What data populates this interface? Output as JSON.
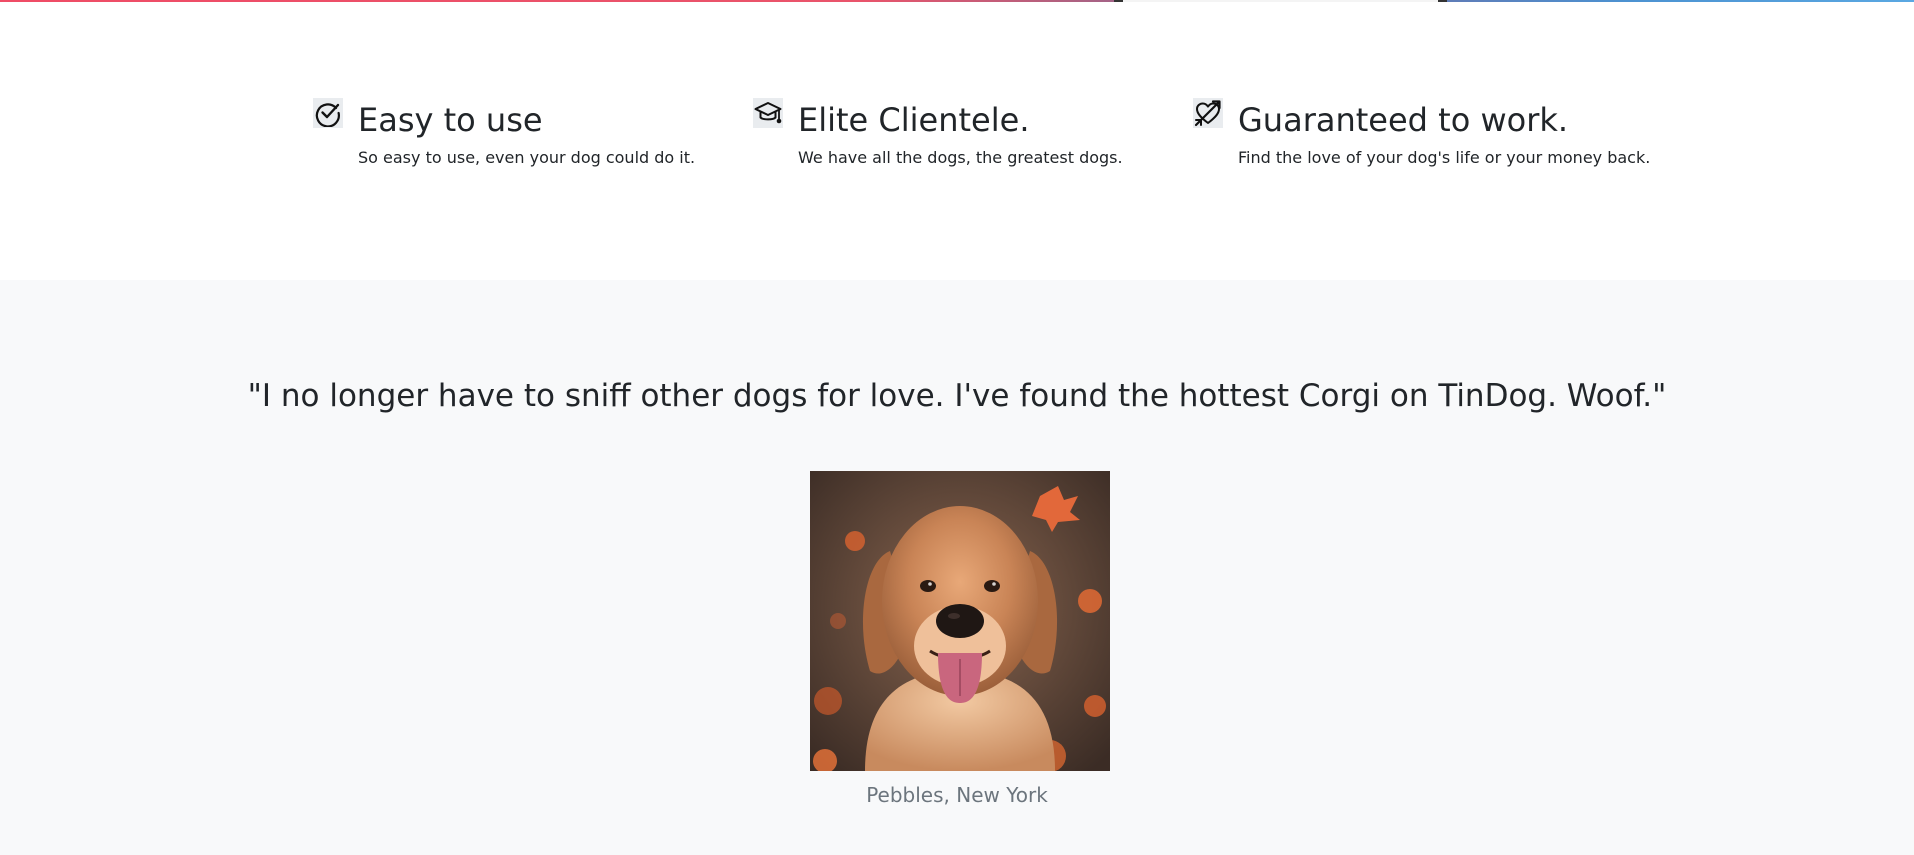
{
  "features": [
    {
      "icon": "check-circle-icon",
      "title": "Easy to use",
      "text": "So easy to use, even your dog could do it."
    },
    {
      "icon": "graduation-cap-icon",
      "title": "Elite Clientele.",
      "text": "We have all the dogs, the greatest dogs."
    },
    {
      "icon": "heart-arrow-icon",
      "title": "Guaranteed to work.",
      "text": "Find the love of your dog's life or your money back."
    }
  ],
  "testimonial": {
    "quote": "\"I no longer have to sniff other dogs for love. I've found the hottest Corgi on TinDog. Woof.\"",
    "caption": "Pebbles, New York"
  }
}
